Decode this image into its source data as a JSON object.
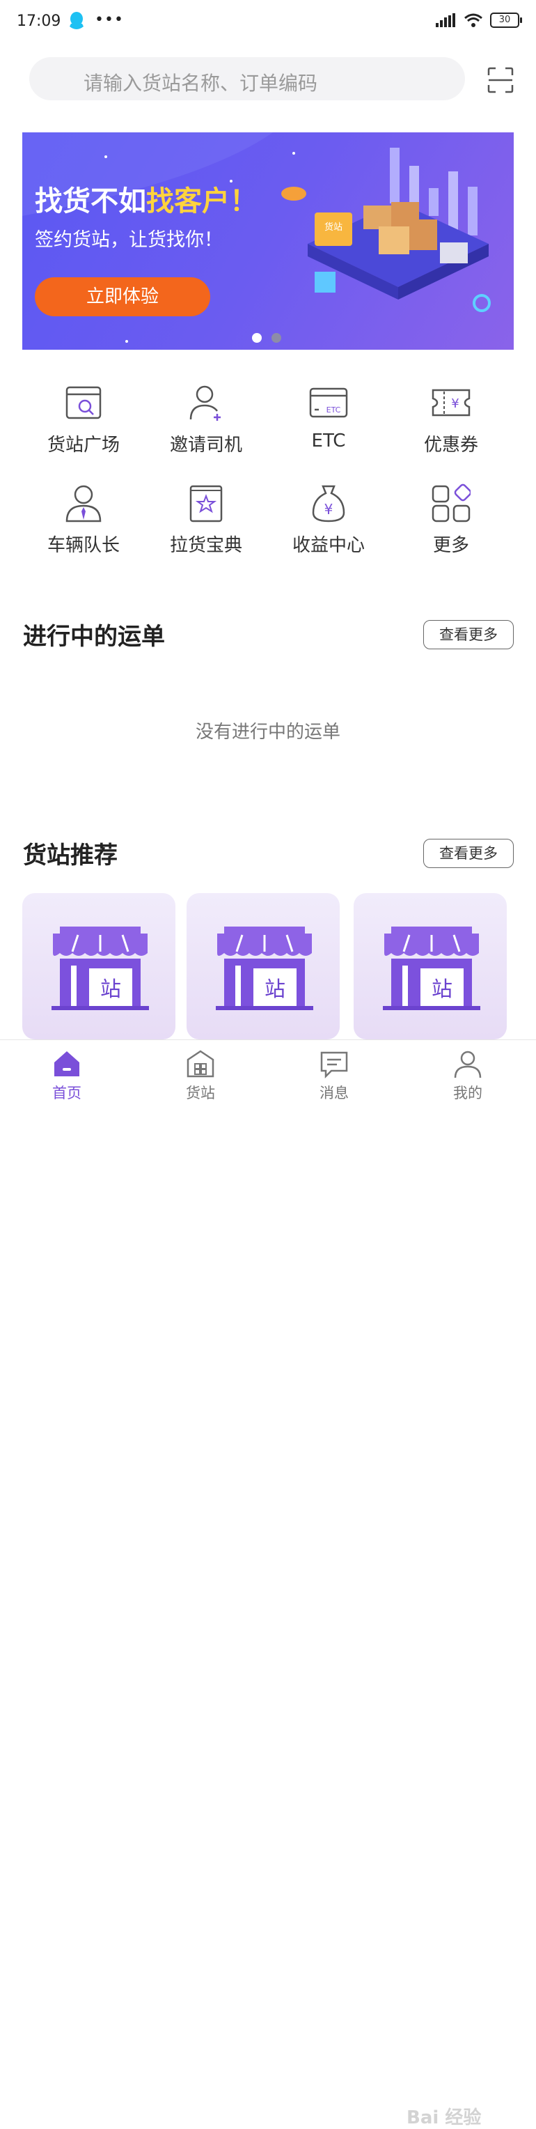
{
  "status": {
    "time": "17:09",
    "battery": "30"
  },
  "search": {
    "placeholder": "请输入货站名称、订单编码"
  },
  "banner": {
    "title_prefix": "找货不如",
    "title_highlight": "找客户！",
    "subtitle": "签约货站，让货找你！",
    "button": "立即体验",
    "crate_label": "货站",
    "colors": {
      "accent": "#ffd33d",
      "button": "#f3661c"
    }
  },
  "grid": [
    {
      "label": "货站广场",
      "icon": "station-search-icon"
    },
    {
      "label": "邀请司机",
      "icon": "invite-user-icon"
    },
    {
      "label": "ETC",
      "icon": "etc-card-icon"
    },
    {
      "label": "优惠券",
      "icon": "coupon-icon"
    },
    {
      "label": "车辆队长",
      "icon": "captain-icon"
    },
    {
      "label": "拉货宝典",
      "icon": "guide-book-icon"
    },
    {
      "label": "收益中心",
      "icon": "money-bag-icon"
    },
    {
      "label": "更多",
      "icon": "more-apps-icon"
    }
  ],
  "orders": {
    "title": "进行中的运单",
    "more": "查看更多",
    "empty": "没有进行中的运单"
  },
  "stations": {
    "title": "货站推荐",
    "more": "查看更多",
    "card_label": "站"
  },
  "tabs": [
    {
      "label": "首页",
      "icon": "home-icon",
      "active": true
    },
    {
      "label": "货站",
      "icon": "station-icon"
    },
    {
      "label": "消息",
      "icon": "message-icon"
    },
    {
      "label": "我的",
      "icon": "profile-icon"
    }
  ],
  "watermark": "Bai 经验",
  "colors": {
    "primary": "#7a4fd9"
  }
}
